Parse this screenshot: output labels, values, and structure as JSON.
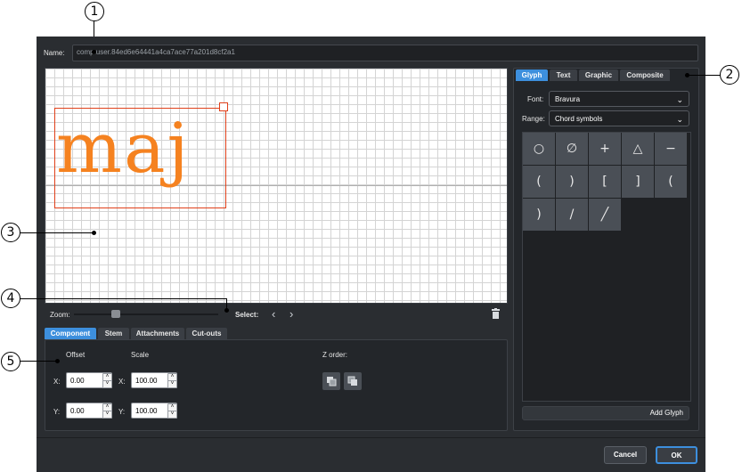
{
  "callouts": [
    "1",
    "2",
    "3",
    "4",
    "5"
  ],
  "name": {
    "label": "Name:",
    "value": "comp.user.84ed6e64441a4ca7ace77a201d8cf2a1"
  },
  "canvas": {
    "glyph_text": "maj"
  },
  "zoom": {
    "label": "Zoom:",
    "level": 0.3
  },
  "select": {
    "label": "Select:",
    "prev": "‹",
    "next": "›"
  },
  "bottom_tabs": [
    "Component",
    "Stem",
    "Attachments",
    "Cut-outs"
  ],
  "component": {
    "offset_label": "Offset",
    "scale_label": "Scale",
    "zorder_label": "Z order:",
    "x_label": "X:",
    "y_label": "Y:",
    "offset_x": "0.00",
    "offset_y": "0.00",
    "scale_x": "100.00",
    "scale_y": "100.00"
  },
  "right_tabs": [
    "Glyph",
    "Text",
    "Graphic",
    "Composite"
  ],
  "font": {
    "label": "Font:",
    "value": "Bravura"
  },
  "range": {
    "label": "Range:",
    "value": "Chord symbols"
  },
  "glyphs": [
    "○",
    "∅",
    "+",
    "△",
    "−",
    "(",
    ")",
    "[",
    "]",
    "(",
    ")",
    "/",
    "╱"
  ],
  "add_glyph_label": "Add Glyph",
  "footer": {
    "cancel": "Cancel",
    "ok": "OK"
  },
  "colors": {
    "accent": "#3d8fdd",
    "glyph": "#f58220",
    "selection": "#e0401a"
  }
}
